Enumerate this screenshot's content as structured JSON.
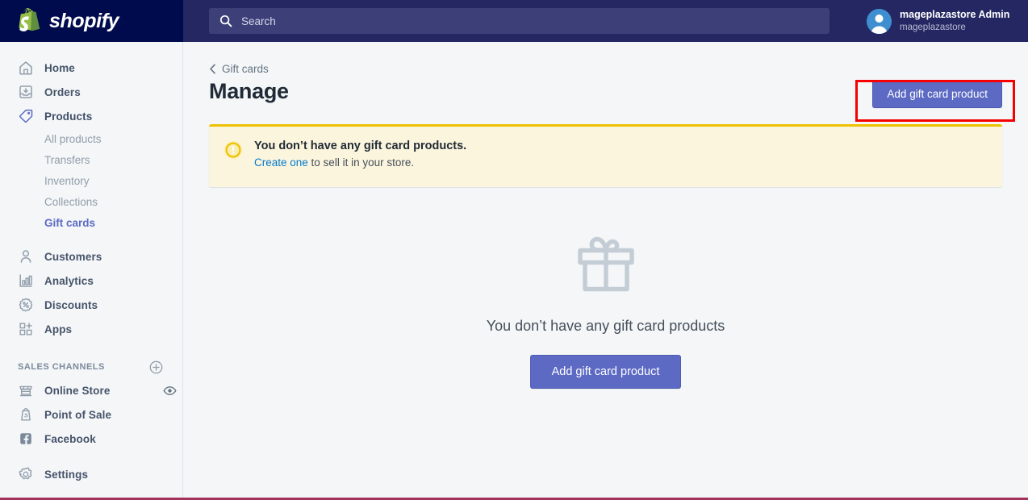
{
  "topbar": {
    "logo_text": "shopify",
    "logo_icon": "shopify-bag-icon",
    "search": {
      "placeholder": "Search",
      "value": "",
      "icon": "search-icon"
    },
    "user": {
      "name": "mageplazastore Admin",
      "store": "mageplazastore",
      "avatar_icon": "user-avatar-icon"
    },
    "colors": {
      "bar": "#242761",
      "logo_zone": "#000b4d",
      "search_field": "#3d4078"
    }
  },
  "sidebar": {
    "items": [
      {
        "label": "Home",
        "icon": "home-icon",
        "active": false
      },
      {
        "label": "Orders",
        "icon": "orders-inbox-icon",
        "active": false
      },
      {
        "label": "Products",
        "icon": "products-tag-icon",
        "active": true
      }
    ],
    "sub_items": [
      {
        "label": "All products",
        "active": false
      },
      {
        "label": "Transfers",
        "active": false
      },
      {
        "label": "Inventory",
        "active": false
      },
      {
        "label": "Collections",
        "active": false
      },
      {
        "label": "Gift cards",
        "active": true
      }
    ],
    "items2": [
      {
        "label": "Customers",
        "icon": "customers-person-icon"
      },
      {
        "label": "Analytics",
        "icon": "analytics-bar-chart-icon"
      },
      {
        "label": "Discounts",
        "icon": "discounts-percent-icon"
      },
      {
        "label": "Apps",
        "icon": "apps-grid-plus-icon"
      }
    ],
    "section": {
      "title": "SALES CHANNELS",
      "add_icon": "plus-circle-icon"
    },
    "channels": [
      {
        "label": "Online Store",
        "icon": "online-store-icon",
        "trail_icon": "eye-icon"
      },
      {
        "label": "Point of Sale",
        "icon": "point-of-sale-bag-icon",
        "trail_icon": ""
      },
      {
        "label": "Facebook",
        "icon": "facebook-icon",
        "trail_icon": ""
      }
    ],
    "settings": {
      "label": "Settings",
      "icon": "gear-icon"
    },
    "active_color": "#5c6ac4"
  },
  "main": {
    "breadcrumb": {
      "label": "Gift cards",
      "icon": "chevron-left-icon"
    },
    "page_title": "Manage",
    "primary_action": "Add gift card product",
    "banner": {
      "icon": "alert-circle-icon",
      "title": "You don’t have any gift card products.",
      "link_text": "Create one",
      "sub_rest": " to sell it in your store.",
      "bg": "#fcf5dd",
      "border": "#eec200"
    },
    "empty_state": {
      "icon": "gift-box-icon",
      "text": "You don’t have any gift card products",
      "button": "Add gift card product"
    },
    "highlight": {
      "color": "#f60000",
      "target": "Add gift card product"
    }
  }
}
